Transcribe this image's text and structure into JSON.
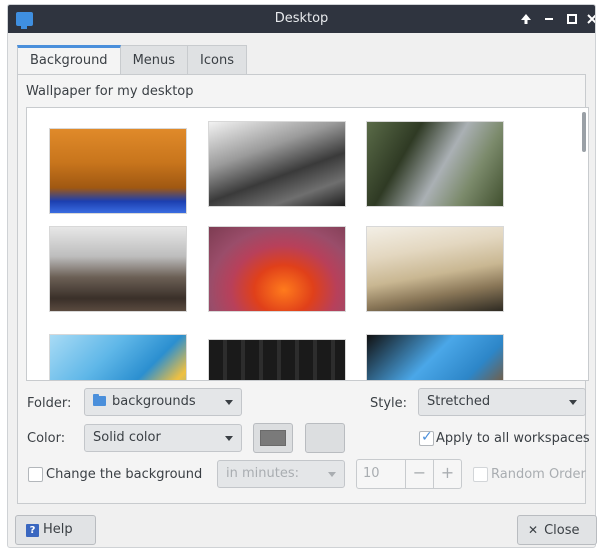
{
  "window": {
    "title": "Desktop",
    "colors": {
      "titlebar": "#2f343f",
      "accent": "#4a8fdb",
      "app_icon": "#3f8fe0"
    }
  },
  "titlebar_buttons": {
    "up_icon": "up-arrow-icon",
    "minimize_icon": "minimize-icon",
    "maximize_icon": "maximize-icon",
    "close_icon": "close-icon"
  },
  "tabs": [
    {
      "label": "Background",
      "active": true
    },
    {
      "label": "Menus",
      "active": false
    },
    {
      "label": "Icons",
      "active": false
    }
  ],
  "background": {
    "section_label": "Wallpaper for my desktop",
    "thumbnails": [
      "wallpaper-alpha-orange",
      "wallpaper-bw-building",
      "wallpaper-waterfall",
      "wallpaper-foggy-landscape",
      "wallpaper-bee-flower",
      "wallpaper-sunset-fog",
      "wallpaper-blue-curves",
      "wallpaper-dark-machinery",
      "wallpaper-blue-sphere"
    ]
  },
  "folder": {
    "label": "Folder:",
    "value": "backgrounds"
  },
  "style": {
    "label": "Style:",
    "value": "Stretched"
  },
  "color": {
    "label": "Color:",
    "value": "Solid color",
    "primary_color": "#7a7a7a",
    "secondary_color": "#dcdee0"
  },
  "apply_all": {
    "label": "Apply to all workspaces",
    "checked": true
  },
  "change_background": {
    "label": "Change the background",
    "checked": false,
    "interval_unit": "in minutes:",
    "interval_value": "10",
    "decrement": "−",
    "increment": "+",
    "random_label": "Random Order",
    "random_checked": false
  },
  "buttons": {
    "help_label": "Help",
    "close_label": "Close"
  }
}
